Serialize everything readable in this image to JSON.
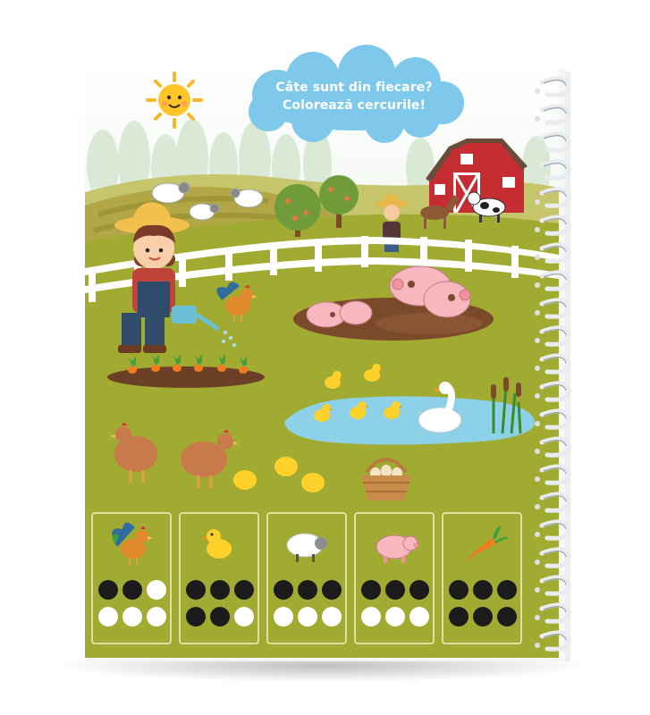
{
  "instruction": {
    "line1": "Câte sunt din fiecare?",
    "line2": "Colorează cercurile!"
  },
  "colors": {
    "page_background": "#a2ab31",
    "sky": "#ffffff",
    "cloud": "#7ec8ec",
    "barn": "#c62d33",
    "mud": "#7b4a2b",
    "pond": "#8cd1e8",
    "fence": "#ffffff",
    "panel_border": "#f4efc8",
    "spiral": "#e9ecef",
    "filled_circle": "#1b1b1b",
    "empty_circle": "#ffffff"
  },
  "counting_panels": [
    {
      "animal": "rooster-icon",
      "filled": 2,
      "total": 6
    },
    {
      "animal": "duckling-icon",
      "filled": 5,
      "total": 6
    },
    {
      "animal": "sheep-icon",
      "filled": 3,
      "total": 6
    },
    {
      "animal": "pig-icon",
      "filled": 3,
      "total": 6
    },
    {
      "animal": "carrot-icon",
      "filled": 6,
      "total": 6
    }
  ],
  "spiral_rings": 21
}
